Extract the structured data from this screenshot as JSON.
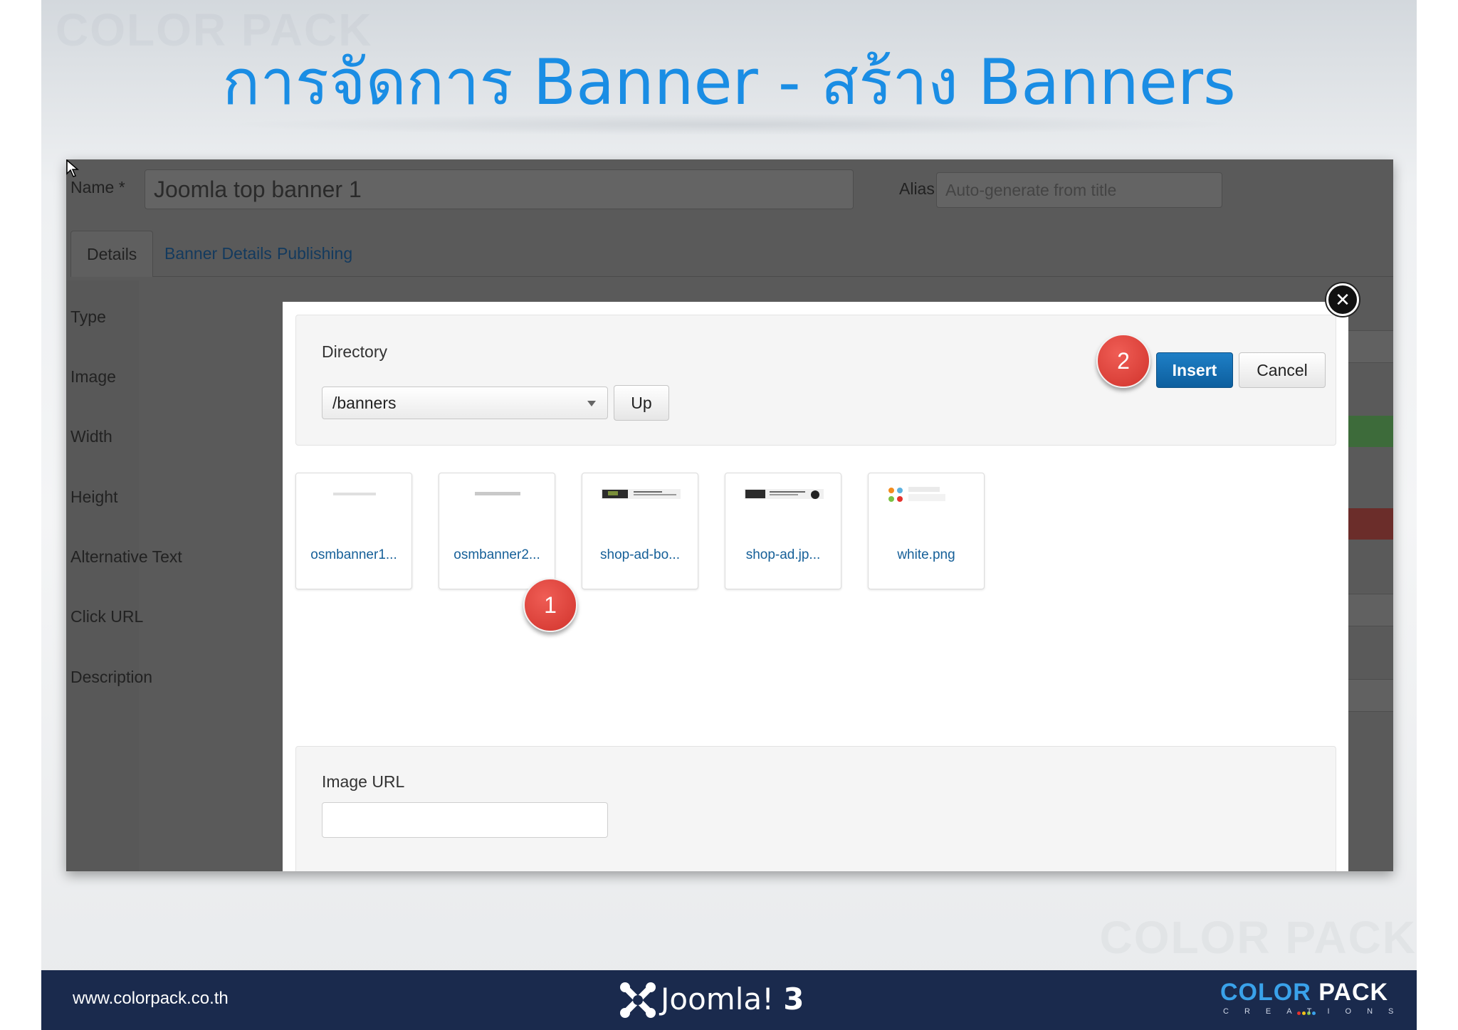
{
  "slide": {
    "title": "การจัดการ Banner - สร้าง Banners",
    "watermark": "COLOR PACK"
  },
  "form": {
    "name_label": "Name *",
    "name_value": "Joomla top banner 1",
    "alias_label": "Alias",
    "alias_placeholder": "Auto-generate from title",
    "tabs": [
      {
        "label": "Details",
        "active": true
      },
      {
        "label": "Banner Details",
        "active": false
      },
      {
        "label": "Publishing",
        "active": false
      }
    ],
    "fields": [
      "Type",
      "Image",
      "Width",
      "Height",
      "Alternative Text",
      "Click URL",
      "Description"
    ]
  },
  "modal": {
    "directory_label": "Directory",
    "directory_value": "/banners",
    "up_label": "Up",
    "insert_label": "Insert",
    "cancel_label": "Cancel",
    "close_icon": "close-icon",
    "files": [
      {
        "name": "osmbanner1...",
        "thumb": "OpenSourceMatters"
      },
      {
        "name": "osmbanner2...",
        "thumb": "OpenSourceMatters"
      },
      {
        "name": "shop-ad-bo...",
        "thumb": "shop ad banner"
      },
      {
        "name": "shop-ad.jp...",
        "thumb": "shop ad banner"
      },
      {
        "name": "white.png",
        "thumb": "SUPPORT Joomla!"
      }
    ],
    "image_url_label": "Image URL",
    "image_url_value": ""
  },
  "annotations": {
    "step1": "1",
    "step2": "2"
  },
  "footer": {
    "website": "www.colorpack.co.th",
    "joomla_brand": "Joomla!",
    "joomla_version": "3",
    "logo_color": "COLOR",
    "logo_pack": "PACK",
    "logo_sub": "CREATIONS"
  },
  "colors": {
    "title_blue": "#1a8de4",
    "insert_blue": "#0d5f9e",
    "badge_red": "#d1332c",
    "footer_navy": "#1a2a4d"
  }
}
